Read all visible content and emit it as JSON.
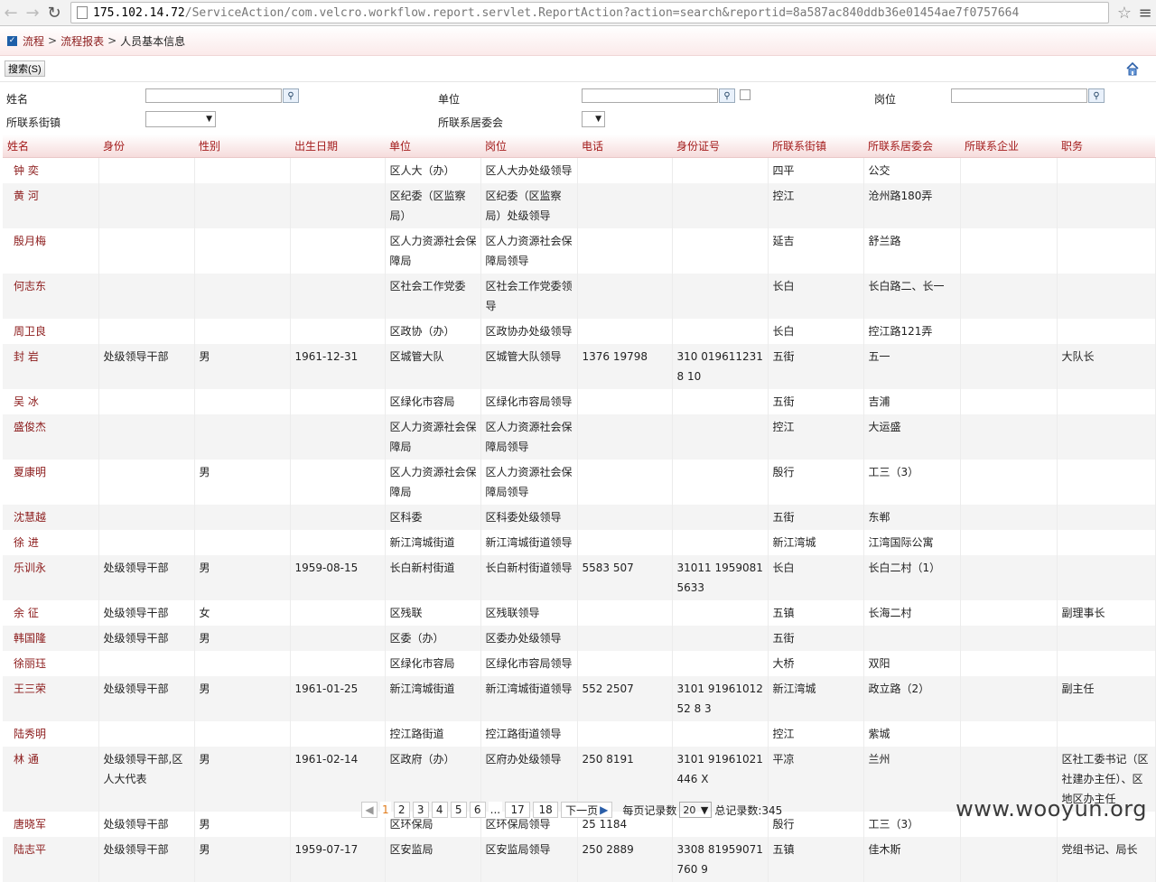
{
  "browser": {
    "url_host": "175.102.14.72",
    "url_path": "/ServiceAction/com.velcro.workflow.report.servlet.ReportAction?action=search&reportid=8a587ac840ddb36e01454ae7f0757664"
  },
  "breadcrumb": {
    "root": "流程",
    "sep1": ">",
    "reports": "流程报表",
    "sep2": ">",
    "current": "人员基本信息"
  },
  "toolbar": {
    "search_label": "搜索(S)"
  },
  "form": {
    "name_label": "姓名",
    "unit_label": "单位",
    "post_label": "岗位",
    "street_label": "所联系街镇",
    "committee_label": "所联系居委会"
  },
  "columns": [
    "姓名",
    "身份",
    "性别",
    "出生日期",
    "单位",
    "岗位",
    "电话",
    "身份证号",
    "所联系街镇",
    "所联系居委会",
    "所联系企业",
    "职务"
  ],
  "rows": [
    [
      "钟 奕",
      "",
      "",
      "",
      "区人大（办）",
      "区人大办处级领导",
      "",
      "",
      "四平",
      "公交",
      "",
      ""
    ],
    [
      "黄 河",
      "",
      "",
      "",
      "区纪委（区监察局）",
      "区纪委（区监察局）处级领导",
      "",
      "",
      "控江",
      "沧州路180弄",
      "",
      ""
    ],
    [
      "殷月梅",
      "",
      "",
      "",
      "区人力资源社会保障局",
      "区人力资源社会保障局领导",
      "",
      "",
      "延吉",
      "舒兰路",
      "",
      ""
    ],
    [
      "何志东",
      "",
      "",
      "",
      "区社会工作党委",
      "区社会工作党委领导",
      "",
      "",
      "长白",
      "长白路二、长一",
      "",
      ""
    ],
    [
      "周卫良",
      "",
      "",
      "",
      "区政协（办）",
      "区政协办处级领导",
      "",
      "",
      "长白",
      "控江路121弄",
      "",
      ""
    ],
    [
      "封 岩",
      "处级领导干部",
      "男",
      "1961-12-31",
      "区城管大队",
      "区城管大队领导",
      "1376  19798",
      "310  0196112318  10",
      "五街",
      "五一",
      "",
      "大队长"
    ],
    [
      "吴 冰",
      "",
      "",
      "",
      "区绿化市容局",
      "区绿化市容局领导",
      "",
      "",
      "五街",
      "吉浦",
      "",
      ""
    ],
    [
      "盛俊杰",
      "",
      "",
      "",
      "区人力资源社会保障局",
      "区人力资源社会保障局领导",
      "",
      "",
      "控江",
      "大运盛",
      "",
      ""
    ],
    [
      "夏康明",
      "",
      "男",
      "",
      "区人力资源社会保障局",
      "区人力资源社会保障局领导",
      "",
      "",
      "殷行",
      "工三（3）",
      "",
      ""
    ],
    [
      "沈慧越",
      "",
      "",
      "",
      "区科委",
      "区科委处级领导",
      "",
      "",
      "五街",
      "东郸",
      "",
      ""
    ],
    [
      "徐 进",
      "",
      "",
      "",
      "新江湾城街道",
      "新江湾城街道领导",
      "",
      "",
      "新江湾城",
      "江湾国际公寓",
      "",
      ""
    ],
    [
      "乐训永",
      "处级领导干部",
      "男",
      "1959-08-15",
      "长白新村街道",
      "长白新村街道领导",
      "5583  507",
      "31011  19590815633",
      "长白",
      "长白二村（1）",
      "",
      ""
    ],
    [
      "余 征",
      "处级领导干部",
      "女",
      "",
      "区残联",
      "区残联领导",
      "",
      "",
      "五镇",
      "长海二村",
      "",
      "副理事长"
    ],
    [
      "韩国隆",
      "处级领导干部",
      "男",
      "",
      "区委（办）",
      "区委办处级领导",
      "",
      "",
      "五街",
      "",
      "",
      ""
    ],
    [
      "徐丽珏",
      "",
      "",
      "",
      "区绿化市容局",
      "区绿化市容局领导",
      "",
      "",
      "大桥",
      "双阳",
      "",
      ""
    ],
    [
      "王三荣",
      "处级领导干部",
      "男",
      "1961-01-25",
      "新江湾城街道",
      "新江湾城街道领导",
      "552  2507",
      "3101  9196101252 8 3",
      "新江湾城",
      "政立路（2）",
      "",
      "副主任"
    ],
    [
      "陆秀明",
      "",
      "",
      "",
      "控江路街道",
      "控江路街道领导",
      "",
      "",
      "控江",
      "紫城",
      "",
      ""
    ],
    [
      "林 通",
      "处级领导干部,区人大代表",
      "男",
      "1961-02-14",
      "区政府（办）",
      "区府办处级领导",
      "250  8191",
      "3101  91961021446  X",
      "平凉",
      "兰州",
      "",
      "区社工委书记（区社建办主任）、区地区办主任"
    ],
    [
      "唐晓军",
      "处级领导干部",
      "男",
      "",
      "区环保局",
      "区环保局领导",
      "25  1184",
      "",
      "殷行",
      "工三（3）",
      "",
      ""
    ],
    [
      "陆志平",
      "处级领导干部",
      "男",
      "1959-07-17",
      "区安监局",
      "区安监局领导",
      "250  2889",
      "3308  81959071760  9",
      "五镇",
      "佳木斯",
      "",
      "党组书记、局长"
    ]
  ],
  "pager": {
    "current": "1",
    "pages": [
      "2",
      "3",
      "4",
      "5",
      "6"
    ],
    "ellipsis": "...",
    "tail_pages": [
      "17",
      "18"
    ],
    "next_label": "下一页",
    "per_page_label": "每页记录数",
    "per_page_value": "20",
    "total_label": "总记录数:345"
  },
  "watermark": "www.wooyun.org"
}
